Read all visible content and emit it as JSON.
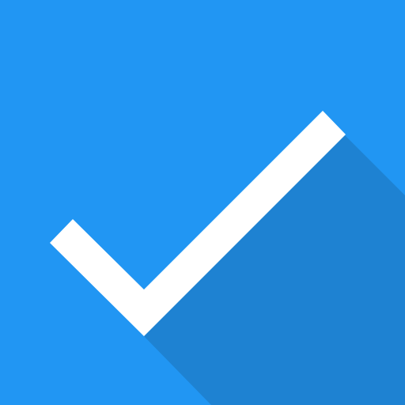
{
  "icon": {
    "name": "checkmark-icon",
    "colors": {
      "background": "#2196F3",
      "long_shadow": "#1E82D2",
      "check": "#FFFFFF"
    }
  }
}
